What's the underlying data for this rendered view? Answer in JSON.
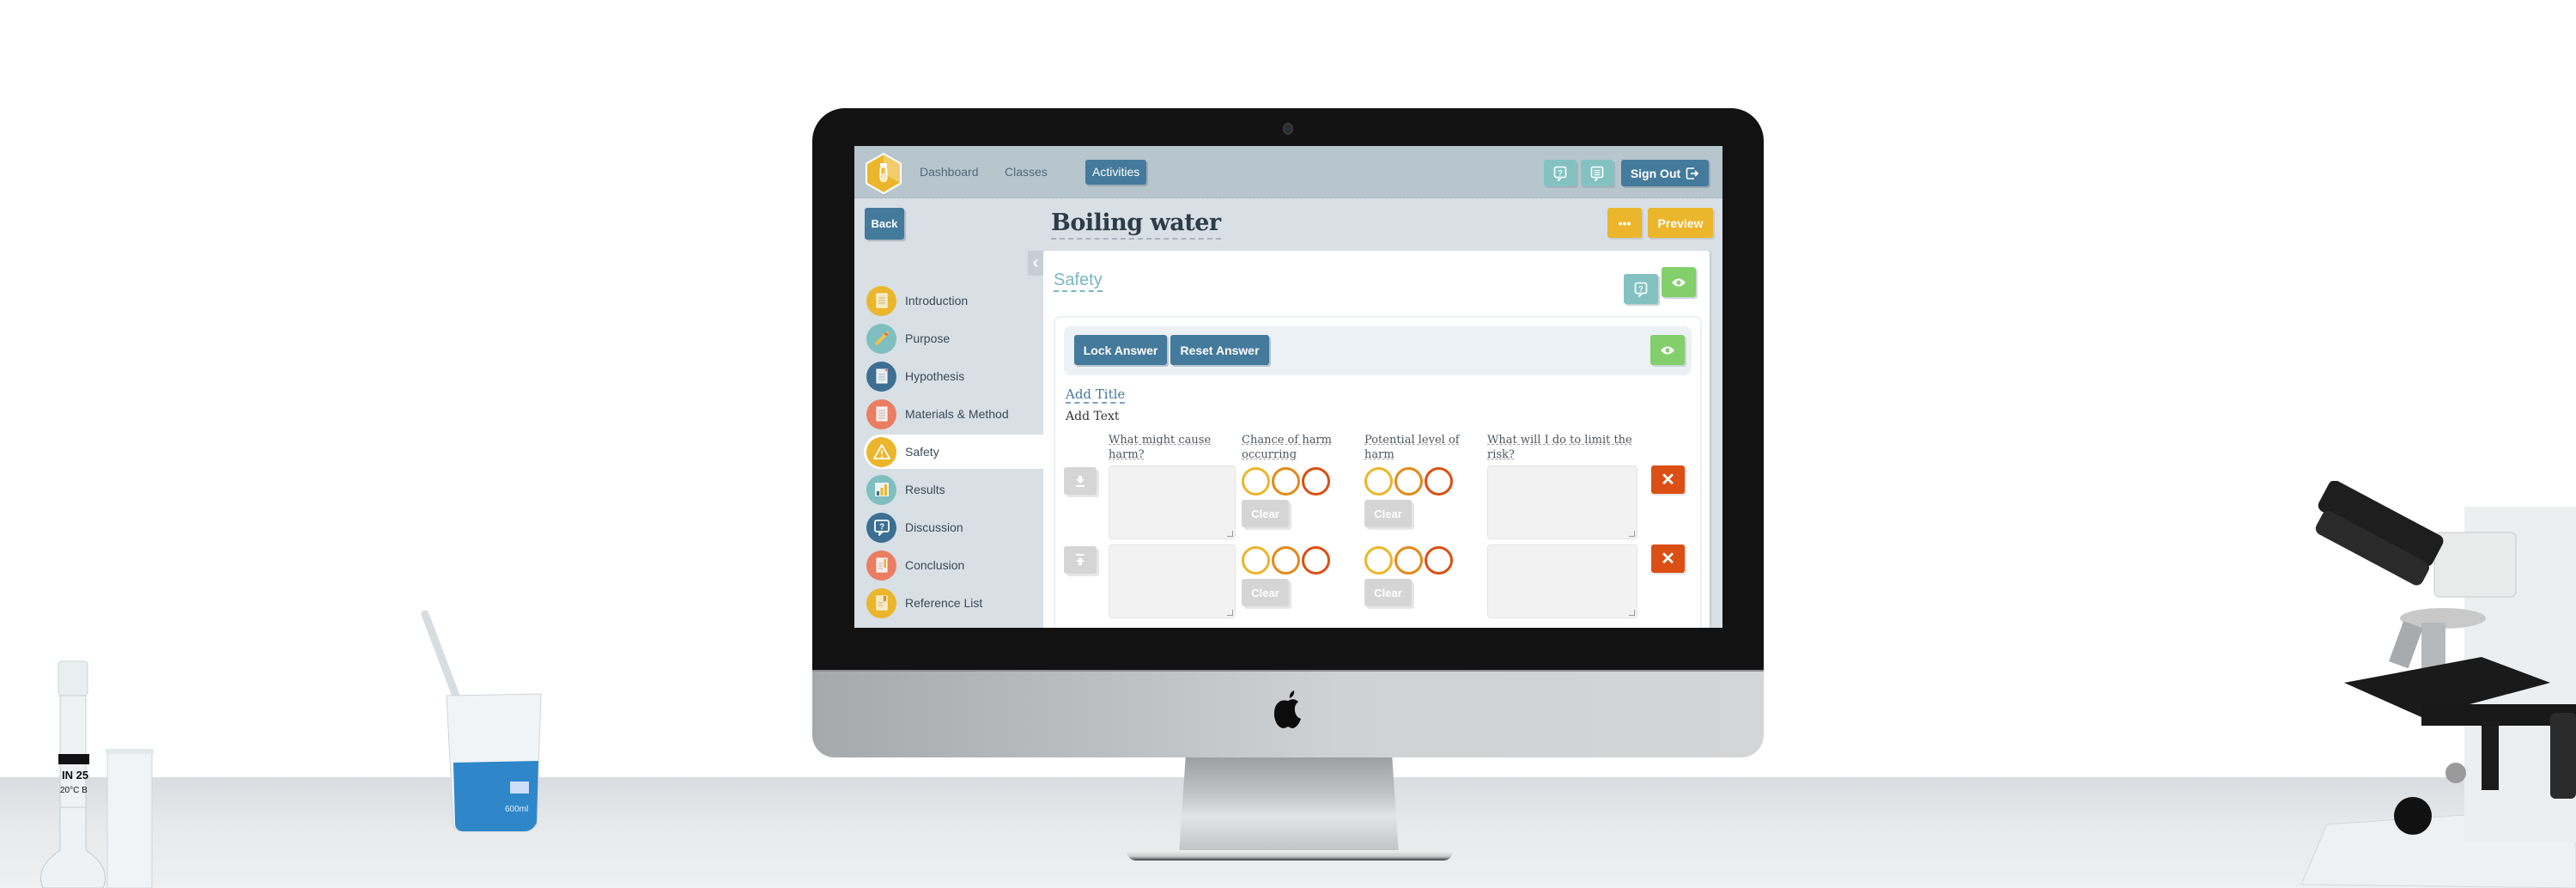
{
  "app": {
    "nav": [
      {
        "label": "Dashboard",
        "active": false
      },
      {
        "label": "Classes",
        "active": false
      },
      {
        "label": "Activities",
        "active": true
      }
    ],
    "header_icons": [
      "help-icon",
      "feedback-icon"
    ],
    "sign_out_label": "Sign Out",
    "back_label": "Back",
    "page_title": "Boiling water",
    "more_label": "•••",
    "preview_label": "Preview"
  },
  "sidebar": {
    "collapse_icon": "chevron-left-icon",
    "items": [
      {
        "label": "Introduction",
        "icon": "document-icon",
        "color": "#ebb62b",
        "active": false
      },
      {
        "label": "Purpose",
        "icon": "pencil-icon",
        "color": "#7fbfbf",
        "active": false
      },
      {
        "label": "Hypothesis",
        "icon": "document-icon",
        "color": "#3c6f92",
        "active": false
      },
      {
        "label": "Materials & Method",
        "icon": "list-icon",
        "color": "#eb7d62",
        "active": false
      },
      {
        "label": "Safety",
        "icon": "warning-icon",
        "color": "#ebb62b",
        "active": true
      },
      {
        "label": "Results",
        "icon": "bar-chart-icon",
        "color": "#7fbfbf",
        "active": false
      },
      {
        "label": "Discussion",
        "icon": "question-bubble-icon",
        "color": "#3c6f92",
        "active": false
      },
      {
        "label": "Conclusion",
        "icon": "notes-icon",
        "color": "#eb7d62",
        "active": false
      },
      {
        "label": "Reference List",
        "icon": "book-icon",
        "color": "#ebb62b",
        "active": false
      }
    ]
  },
  "section": {
    "title": "Safety",
    "lock_label": "Lock Answer",
    "reset_label": "Reset Answer",
    "add_title": "Add Title",
    "add_text": "Add Text",
    "columns": [
      "What might cause harm?",
      "Chance of harm occurring",
      "Potential level of harm",
      "What will I do to limit the risk?"
    ],
    "rows": [
      {
        "move": "move-down-icon",
        "cause": "",
        "chance": null,
        "level": null,
        "limit": "",
        "clear_label": "Clear"
      },
      {
        "move": "move-up-icon",
        "cause": "",
        "chance": null,
        "level": null,
        "limit": "",
        "clear_label": "Clear"
      }
    ],
    "rating_colors": [
      "#ebb62b",
      "#e28a1b",
      "#db4f14"
    ],
    "delete_label": "✕"
  },
  "scene": {
    "beaker_label": "600ml",
    "flask_label_1": "IN 25",
    "flask_label_2": "20°C B"
  },
  "colors": {
    "primary": "#447a9b",
    "accent_yellow": "#ebb62b",
    "accent_teal": "#84c2c2",
    "accent_green": "#82cf6b",
    "danger": "#db4f14"
  }
}
